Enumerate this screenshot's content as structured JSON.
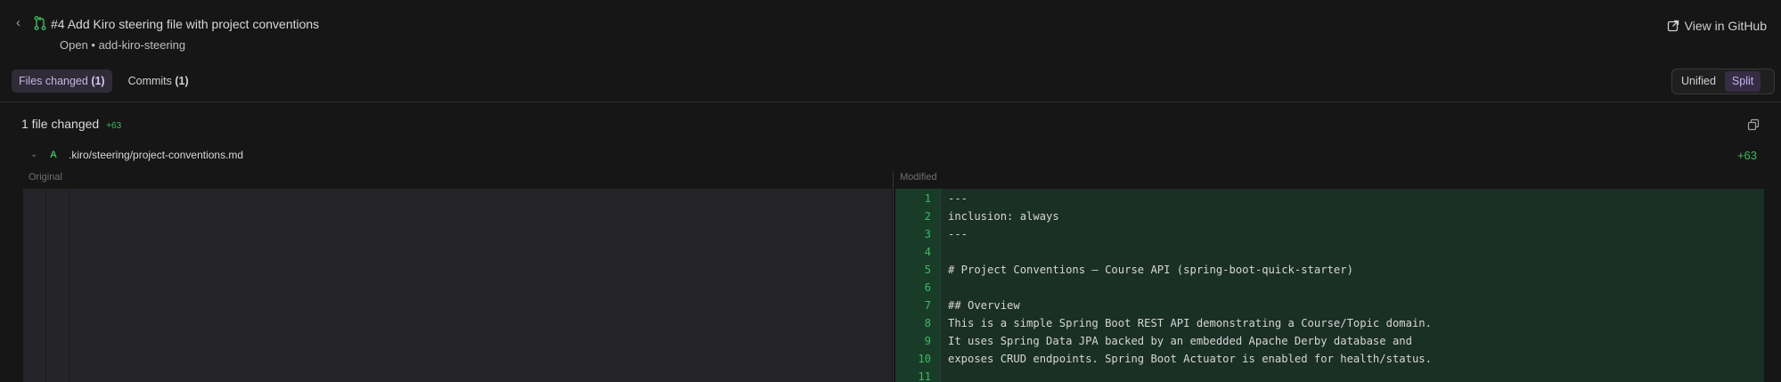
{
  "header": {
    "title": "#4 Add Kiro steering file with project conventions",
    "subtitle": "Open • add-kiro-steering",
    "github_link": "View in GitHub"
  },
  "tabs": [
    {
      "label": "Files changed",
      "count": "(1)"
    },
    {
      "label": "Commits",
      "count": "(1)"
    }
  ],
  "view_toggle": {
    "unified": "Unified",
    "split": "Split"
  },
  "summary": {
    "text": "1 file changed",
    "additions": "+63"
  },
  "file": {
    "badge": "A",
    "name": ".kiro/steering/project-conventions.md",
    "additions": "+63"
  },
  "columns": {
    "original": "Original",
    "modified": "Modified"
  },
  "lines": [
    {
      "n": "1",
      "code": "---"
    },
    {
      "n": "2",
      "code": "inclusion: always"
    },
    {
      "n": "3",
      "code": "---"
    },
    {
      "n": "4",
      "code": ""
    },
    {
      "n": "5",
      "code": "# Project Conventions — Course API (spring-boot-quick-starter)"
    },
    {
      "n": "6",
      "code": ""
    },
    {
      "n": "7",
      "code": "## Overview"
    },
    {
      "n": "8",
      "code": "This is a simple Spring Boot REST API demonstrating a Course/Topic domain."
    },
    {
      "n": "9",
      "code": "It uses Spring Data JPA backed by an embedded Apache Derby database and"
    },
    {
      "n": "10",
      "code": "exposes CRUD endpoints. Spring Boot Actuator is enabled for health/status."
    },
    {
      "n": "11",
      "code": ""
    }
  ],
  "colors": {
    "accent": "#c8b2ef",
    "added": "#3fb760",
    "added_bg": "#1a2f25"
  }
}
